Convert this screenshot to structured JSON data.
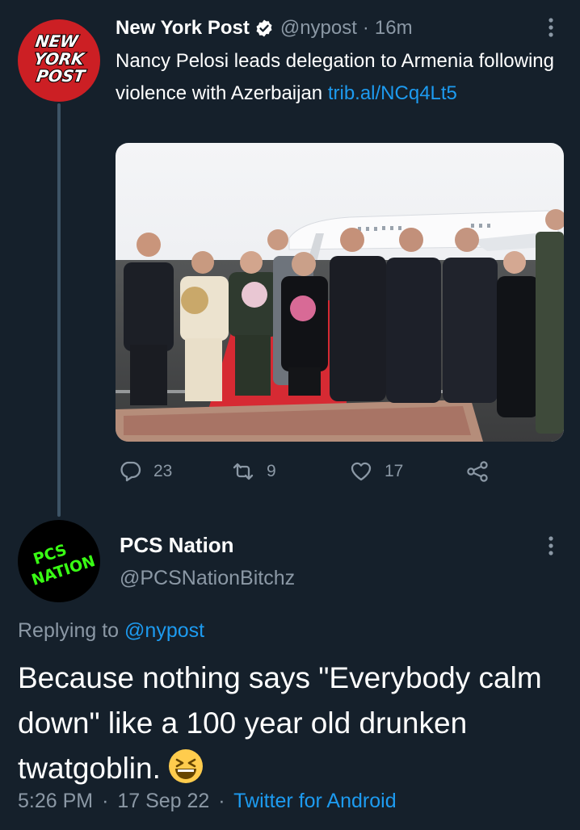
{
  "tweet": {
    "author_name": "New York Post",
    "handle": "@nypost",
    "separator": "·",
    "time": "16m",
    "avatar_lines": [
      "NEW",
      "YORK",
      "POST"
    ],
    "text": "Nancy Pelosi leads delegation to Armenia following violence with Azerbaijan ",
    "link": "trib.al/NCq4Lt5",
    "actions": {
      "replies": "23",
      "retweets": "9",
      "likes": "17"
    }
  },
  "reply": {
    "author_name": "PCS Nation",
    "handle": "@PCSNationBitchz",
    "avatar_lines": [
      "PCS",
      "NATION"
    ],
    "replying_prefix": "Replying to ",
    "replying_handle": "@nypost",
    "text": "Because nothing says \"Everybody calm down\" like a 100 year old drunken twatgoblin.",
    "emoji": "grinning-squinting-face",
    "time": "5:26 PM",
    "dot1": "·",
    "date": "17 Sep 22",
    "dot2": "·",
    "source": "Twitter for Android"
  },
  "colors": {
    "background": "#15202b",
    "text": "#ffffff",
    "muted": "#8b98a5",
    "link": "#1d9bf0",
    "thread_line": "#3d5466",
    "nypost_red": "#cc1f24",
    "pcs_green": "#39ff14"
  },
  "icons": [
    "verified-badge-icon",
    "more-options-icon",
    "reply-icon",
    "retweet-icon",
    "like-icon",
    "share-icon"
  ]
}
